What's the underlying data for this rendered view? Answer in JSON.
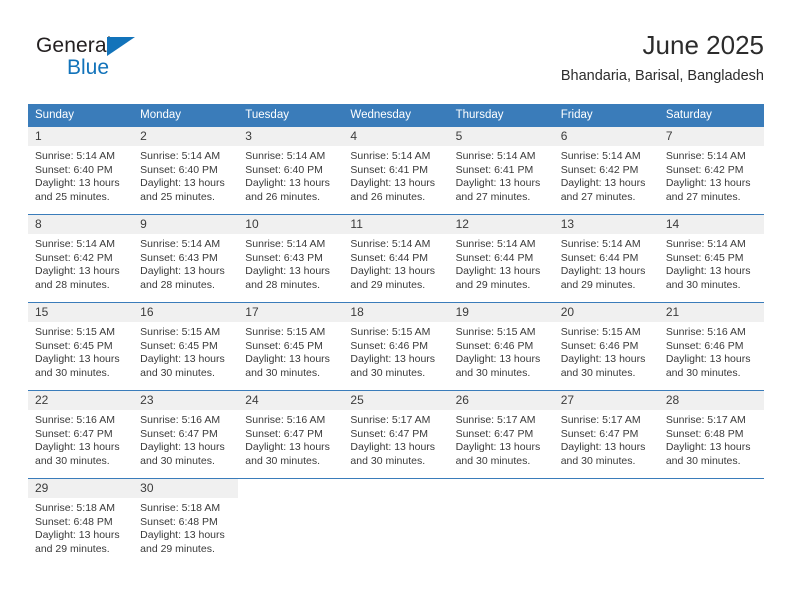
{
  "brand": {
    "name_part1": "General",
    "name_part2": "Blue",
    "accent_color": "#1273ba"
  },
  "header": {
    "title": "June 2025",
    "location": "Bhandaria, Barisal, Bangladesh"
  },
  "theme": {
    "header_bg": "#3a7cba",
    "daynum_bg": "#f0f0f0",
    "text": "#3a3a3a"
  },
  "calendar": {
    "weekday_headers": [
      "Sunday",
      "Monday",
      "Tuesday",
      "Wednesday",
      "Thursday",
      "Friday",
      "Saturday"
    ],
    "weeks": [
      [
        {
          "day": "1",
          "sunrise": "Sunrise: 5:14 AM",
          "sunset": "Sunset: 6:40 PM",
          "daylight_line1": "Daylight: 13 hours",
          "daylight_line2": "and 25 minutes."
        },
        {
          "day": "2",
          "sunrise": "Sunrise: 5:14 AM",
          "sunset": "Sunset: 6:40 PM",
          "daylight_line1": "Daylight: 13 hours",
          "daylight_line2": "and 25 minutes."
        },
        {
          "day": "3",
          "sunrise": "Sunrise: 5:14 AM",
          "sunset": "Sunset: 6:40 PM",
          "daylight_line1": "Daylight: 13 hours",
          "daylight_line2": "and 26 minutes."
        },
        {
          "day": "4",
          "sunrise": "Sunrise: 5:14 AM",
          "sunset": "Sunset: 6:41 PM",
          "daylight_line1": "Daylight: 13 hours",
          "daylight_line2": "and 26 minutes."
        },
        {
          "day": "5",
          "sunrise": "Sunrise: 5:14 AM",
          "sunset": "Sunset: 6:41 PM",
          "daylight_line1": "Daylight: 13 hours",
          "daylight_line2": "and 27 minutes."
        },
        {
          "day": "6",
          "sunrise": "Sunrise: 5:14 AM",
          "sunset": "Sunset: 6:42 PM",
          "daylight_line1": "Daylight: 13 hours",
          "daylight_line2": "and 27 minutes."
        },
        {
          "day": "7",
          "sunrise": "Sunrise: 5:14 AM",
          "sunset": "Sunset: 6:42 PM",
          "daylight_line1": "Daylight: 13 hours",
          "daylight_line2": "and 27 minutes."
        }
      ],
      [
        {
          "day": "8",
          "sunrise": "Sunrise: 5:14 AM",
          "sunset": "Sunset: 6:42 PM",
          "daylight_line1": "Daylight: 13 hours",
          "daylight_line2": "and 28 minutes."
        },
        {
          "day": "9",
          "sunrise": "Sunrise: 5:14 AM",
          "sunset": "Sunset: 6:43 PM",
          "daylight_line1": "Daylight: 13 hours",
          "daylight_line2": "and 28 minutes."
        },
        {
          "day": "10",
          "sunrise": "Sunrise: 5:14 AM",
          "sunset": "Sunset: 6:43 PM",
          "daylight_line1": "Daylight: 13 hours",
          "daylight_line2": "and 28 minutes."
        },
        {
          "day": "11",
          "sunrise": "Sunrise: 5:14 AM",
          "sunset": "Sunset: 6:44 PM",
          "daylight_line1": "Daylight: 13 hours",
          "daylight_line2": "and 29 minutes."
        },
        {
          "day": "12",
          "sunrise": "Sunrise: 5:14 AM",
          "sunset": "Sunset: 6:44 PM",
          "daylight_line1": "Daylight: 13 hours",
          "daylight_line2": "and 29 minutes."
        },
        {
          "day": "13",
          "sunrise": "Sunrise: 5:14 AM",
          "sunset": "Sunset: 6:44 PM",
          "daylight_line1": "Daylight: 13 hours",
          "daylight_line2": "and 29 minutes."
        },
        {
          "day": "14",
          "sunrise": "Sunrise: 5:14 AM",
          "sunset": "Sunset: 6:45 PM",
          "daylight_line1": "Daylight: 13 hours",
          "daylight_line2": "and 30 minutes."
        }
      ],
      [
        {
          "day": "15",
          "sunrise": "Sunrise: 5:15 AM",
          "sunset": "Sunset: 6:45 PM",
          "daylight_line1": "Daylight: 13 hours",
          "daylight_line2": "and 30 minutes."
        },
        {
          "day": "16",
          "sunrise": "Sunrise: 5:15 AM",
          "sunset": "Sunset: 6:45 PM",
          "daylight_line1": "Daylight: 13 hours",
          "daylight_line2": "and 30 minutes."
        },
        {
          "day": "17",
          "sunrise": "Sunrise: 5:15 AM",
          "sunset": "Sunset: 6:45 PM",
          "daylight_line1": "Daylight: 13 hours",
          "daylight_line2": "and 30 minutes."
        },
        {
          "day": "18",
          "sunrise": "Sunrise: 5:15 AM",
          "sunset": "Sunset: 6:46 PM",
          "daylight_line1": "Daylight: 13 hours",
          "daylight_line2": "and 30 minutes."
        },
        {
          "day": "19",
          "sunrise": "Sunrise: 5:15 AM",
          "sunset": "Sunset: 6:46 PM",
          "daylight_line1": "Daylight: 13 hours",
          "daylight_line2": "and 30 minutes."
        },
        {
          "day": "20",
          "sunrise": "Sunrise: 5:15 AM",
          "sunset": "Sunset: 6:46 PM",
          "daylight_line1": "Daylight: 13 hours",
          "daylight_line2": "and 30 minutes."
        },
        {
          "day": "21",
          "sunrise": "Sunrise: 5:16 AM",
          "sunset": "Sunset: 6:46 PM",
          "daylight_line1": "Daylight: 13 hours",
          "daylight_line2": "and 30 minutes."
        }
      ],
      [
        {
          "day": "22",
          "sunrise": "Sunrise: 5:16 AM",
          "sunset": "Sunset: 6:47 PM",
          "daylight_line1": "Daylight: 13 hours",
          "daylight_line2": "and 30 minutes."
        },
        {
          "day": "23",
          "sunrise": "Sunrise: 5:16 AM",
          "sunset": "Sunset: 6:47 PM",
          "daylight_line1": "Daylight: 13 hours",
          "daylight_line2": "and 30 minutes."
        },
        {
          "day": "24",
          "sunrise": "Sunrise: 5:16 AM",
          "sunset": "Sunset: 6:47 PM",
          "daylight_line1": "Daylight: 13 hours",
          "daylight_line2": "and 30 minutes."
        },
        {
          "day": "25",
          "sunrise": "Sunrise: 5:17 AM",
          "sunset": "Sunset: 6:47 PM",
          "daylight_line1": "Daylight: 13 hours",
          "daylight_line2": "and 30 minutes."
        },
        {
          "day": "26",
          "sunrise": "Sunrise: 5:17 AM",
          "sunset": "Sunset: 6:47 PM",
          "daylight_line1": "Daylight: 13 hours",
          "daylight_line2": "and 30 minutes."
        },
        {
          "day": "27",
          "sunrise": "Sunrise: 5:17 AM",
          "sunset": "Sunset: 6:47 PM",
          "daylight_line1": "Daylight: 13 hours",
          "daylight_line2": "and 30 minutes."
        },
        {
          "day": "28",
          "sunrise": "Sunrise: 5:17 AM",
          "sunset": "Sunset: 6:48 PM",
          "daylight_line1": "Daylight: 13 hours",
          "daylight_line2": "and 30 minutes."
        }
      ],
      [
        {
          "day": "29",
          "sunrise": "Sunrise: 5:18 AM",
          "sunset": "Sunset: 6:48 PM",
          "daylight_line1": "Daylight: 13 hours",
          "daylight_line2": "and 29 minutes."
        },
        {
          "day": "30",
          "sunrise": "Sunrise: 5:18 AM",
          "sunset": "Sunset: 6:48 PM",
          "daylight_line1": "Daylight: 13 hours",
          "daylight_line2": "and 29 minutes."
        },
        {
          "day": "",
          "sunrise": "",
          "sunset": "",
          "daylight_line1": "",
          "daylight_line2": ""
        },
        {
          "day": "",
          "sunrise": "",
          "sunset": "",
          "daylight_line1": "",
          "daylight_line2": ""
        },
        {
          "day": "",
          "sunrise": "",
          "sunset": "",
          "daylight_line1": "",
          "daylight_line2": ""
        },
        {
          "day": "",
          "sunrise": "",
          "sunset": "",
          "daylight_line1": "",
          "daylight_line2": ""
        },
        {
          "day": "",
          "sunrise": "",
          "sunset": "",
          "daylight_line1": "",
          "daylight_line2": ""
        }
      ]
    ]
  }
}
